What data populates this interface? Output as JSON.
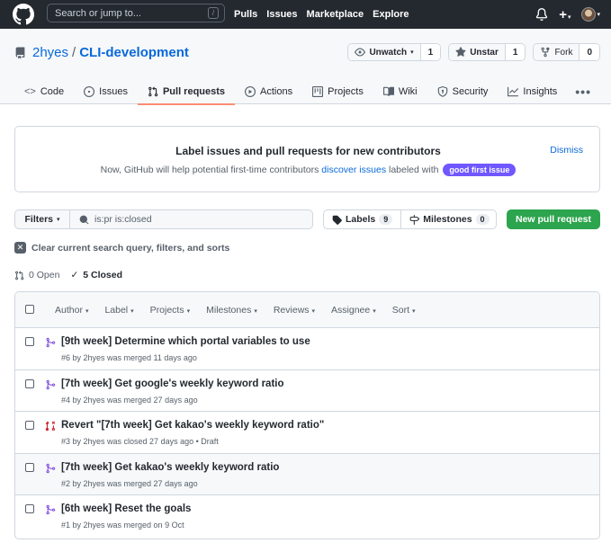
{
  "header": {
    "search_placeholder": "Search or jump to...",
    "search_shortcut": "/",
    "nav": [
      "Pulls",
      "Issues",
      "Marketplace",
      "Explore"
    ],
    "plus": "+"
  },
  "repo": {
    "owner": "2hyes",
    "separator": "/",
    "name": "CLI-development",
    "watch": {
      "label": "Unwatch",
      "count": "1"
    },
    "star": {
      "label": "Unstar",
      "count": "1"
    },
    "fork": {
      "label": "Fork",
      "count": "0"
    }
  },
  "tabs": [
    {
      "label": "Code",
      "icon": "code-icon"
    },
    {
      "label": "Issues",
      "icon": "issue-icon"
    },
    {
      "label": "Pull requests",
      "icon": "pull-request-icon"
    },
    {
      "label": "Actions",
      "icon": "play-icon"
    },
    {
      "label": "Projects",
      "icon": "project-icon"
    },
    {
      "label": "Wiki",
      "icon": "book-icon"
    },
    {
      "label": "Security",
      "icon": "shield-icon"
    },
    {
      "label": "Insights",
      "icon": "graph-icon"
    }
  ],
  "more": "•••",
  "promo": {
    "title": "Label issues and pull requests for new contributors",
    "text_before": "Now, GitHub will help potential first-time contributors",
    "link": "discover issues",
    "text_after": "labeled with",
    "label": "good first issue",
    "dismiss": "Dismiss"
  },
  "filters": {
    "button": "Filters",
    "query": "is:pr is:closed",
    "labels": "Labels",
    "labels_count": "9",
    "milestones": "Milestones",
    "milestones_count": "0",
    "new_pr": "New pull request"
  },
  "clear": "Clear current search query, filters, and sorts",
  "states": {
    "open": "0 Open",
    "closed": "5 Closed"
  },
  "list_header": [
    "Author",
    "Label",
    "Projects",
    "Milestones",
    "Reviews",
    "Assignee",
    "Sort"
  ],
  "pull_requests": [
    {
      "title": "[9th week] Determine which portal variables to use",
      "meta": "#6 by 2hyes was merged 11 days ago",
      "status": "merged"
    },
    {
      "title": "[7th week] Get google's weekly keyword ratio",
      "meta": "#4 by 2hyes was merged 27 days ago",
      "status": "merged"
    },
    {
      "title": "Revert \"[7th week] Get kakao's weekly keyword ratio\"",
      "meta": "#3 by 2hyes was closed 27 days ago • Draft",
      "status": "closed"
    },
    {
      "title": "[7th week] Get kakao's weekly keyword ratio",
      "meta": "#2 by 2hyes was merged 27 days ago",
      "status": "merged"
    },
    {
      "title": "[6th week] Reset the goals",
      "meta": "#1 by 2hyes was merged on 9 Oct",
      "status": "merged"
    }
  ],
  "colors": {
    "header_bg": "#24292f",
    "link": "#0969da",
    "merged": "#8250df",
    "closed": "#cf222e",
    "primary_button": "#2da44e",
    "good_first_issue": "#7057ff",
    "active_tab_underline": "#fd8c73"
  }
}
